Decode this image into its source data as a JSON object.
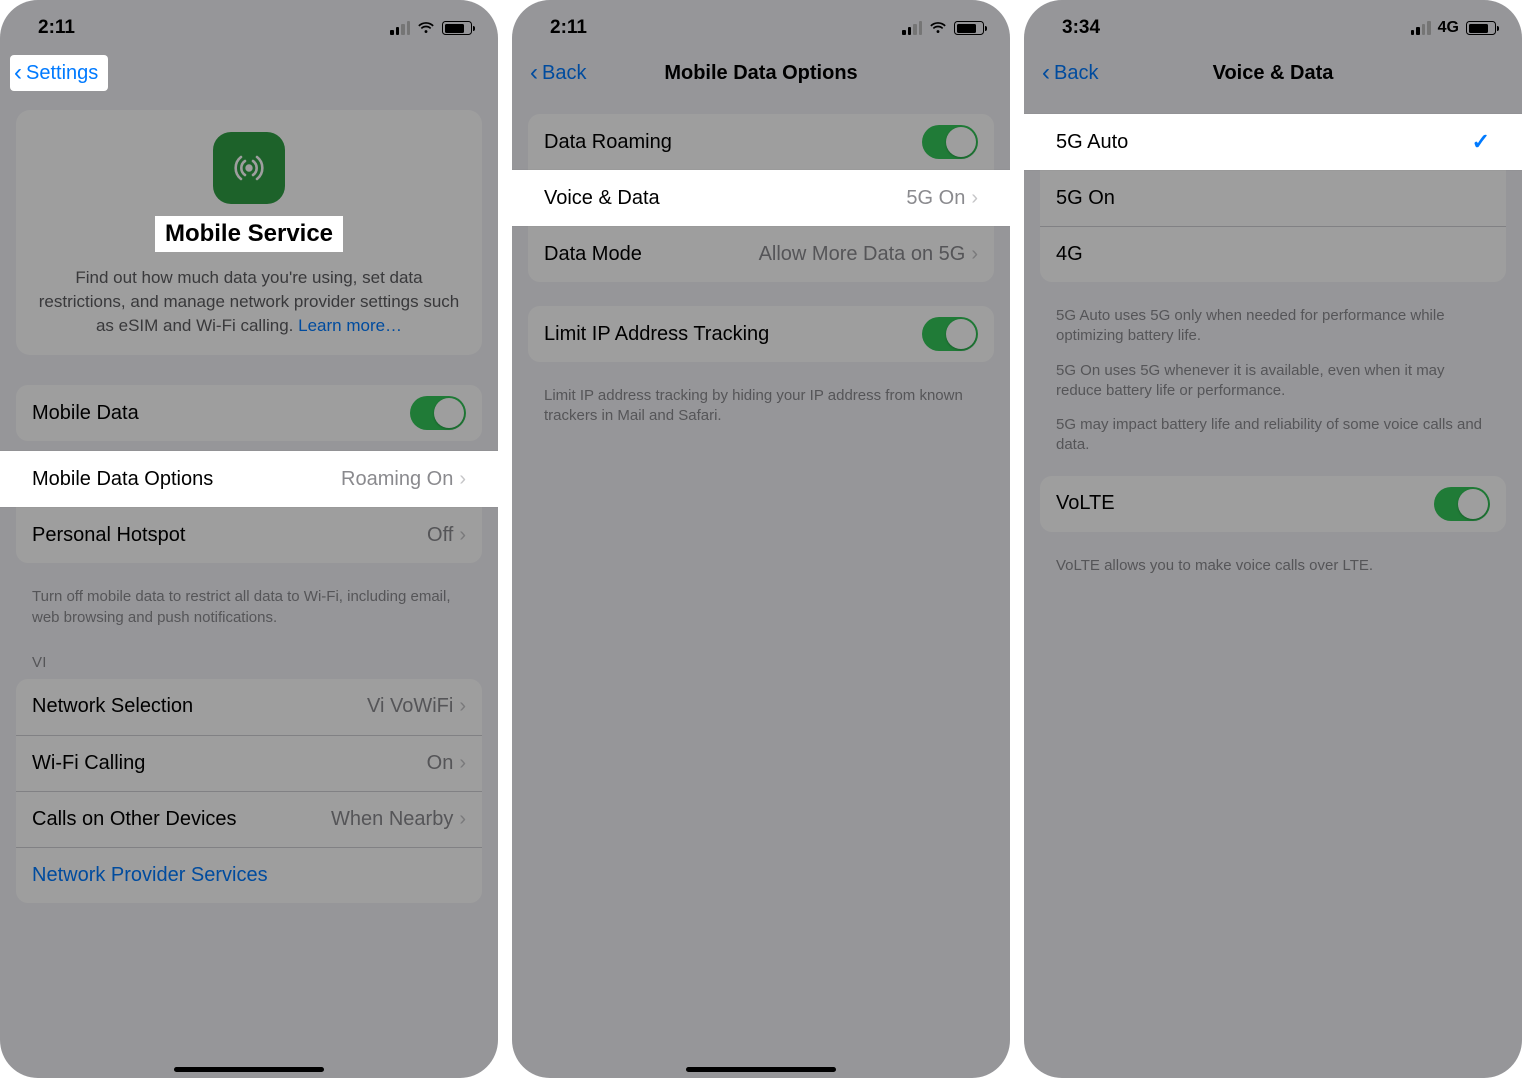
{
  "screen1": {
    "status": {
      "time": "2:11",
      "wifi": true,
      "signal": 2
    },
    "nav": {
      "back": "Settings"
    },
    "hero": {
      "title": "Mobile Service",
      "description_before_link": "Find out how much data you're using, set data restrictions, and manage network provider settings such as eSIM and Wi-Fi calling. ",
      "link": "Learn more…"
    },
    "rows": {
      "mobile_data": "Mobile Data",
      "mobile_data_options": {
        "label": "Mobile Data Options",
        "value": "Roaming On"
      },
      "personal_hotspot": {
        "label": "Personal Hotspot",
        "value": "Off"
      }
    },
    "footer": "Turn off mobile data to restrict all data to Wi-Fi, including email, web browsing and push notifications.",
    "carrier_header": "VI",
    "carrier": {
      "network_selection": {
        "label": "Network Selection",
        "value": "Vi VoWiFi"
      },
      "wifi_calling": {
        "label": "Wi-Fi Calling",
        "value": "On"
      },
      "calls_other": {
        "label": "Calls on Other Devices",
        "value": "When Nearby"
      },
      "provider_services": "Network Provider Services"
    }
  },
  "screen2": {
    "status": {
      "time": "2:11",
      "wifi": true,
      "signal": 2
    },
    "nav": {
      "back": "Back",
      "title": "Mobile Data Options"
    },
    "rows": {
      "data_roaming": "Data Roaming",
      "voice_data": {
        "label": "Voice & Data",
        "value": "5G On"
      },
      "data_mode": {
        "label": "Data Mode",
        "value": "Allow More Data on 5G"
      },
      "limit_ip": "Limit IP Address Tracking"
    },
    "footer": "Limit IP address tracking by hiding your IP address from known trackers in Mail and Safari."
  },
  "screen3": {
    "status": {
      "time": "3:34",
      "net_label": "4G",
      "signal": 2
    },
    "nav": {
      "back": "Back",
      "title": "Voice & Data"
    },
    "options": {
      "auto": "5G Auto",
      "on": "5G On",
      "fourg": "4G"
    },
    "footer1": "5G Auto uses 5G only when needed for performance while optimizing battery life.",
    "footer2": "5G On uses 5G whenever it is available, even when it may reduce battery life or performance.",
    "footer3": "5G may impact battery life and reliability of some voice calls and data.",
    "volte": "VoLTE",
    "volte_footer": "VoLTE allows you to make voice calls over LTE."
  }
}
